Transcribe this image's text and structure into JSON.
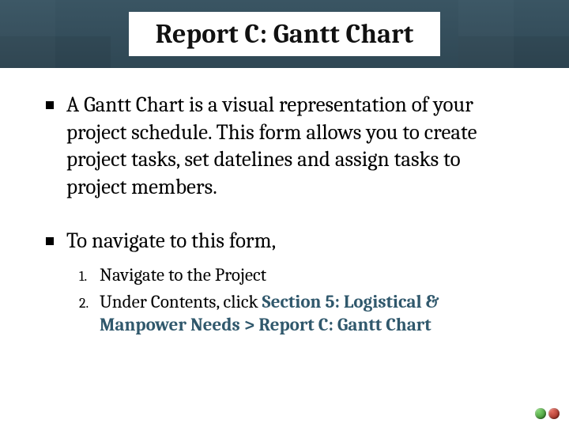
{
  "title": "Report C: Gantt Chart",
  "bullets": [
    {
      "text": "A Gantt Chart is a visual representation of your project schedule.  This form allows you to create project tasks, set datelines and assign tasks to project members."
    },
    {
      "text": "To navigate to this form,"
    }
  ],
  "steps": [
    {
      "num": "1.",
      "text": "Navigate to the Project"
    },
    {
      "num": "2.",
      "prefix": "Under Contents, click ",
      "emph": "Section 5: Logistical & Manpower Needs > Report C: Gantt Chart"
    }
  ]
}
